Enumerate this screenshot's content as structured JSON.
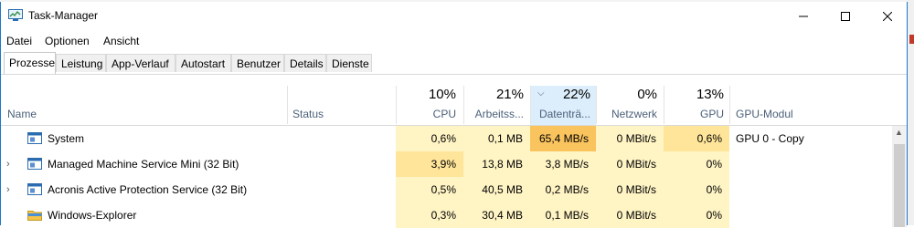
{
  "window": {
    "title": "Task-Manager",
    "accent": "#1979ca"
  },
  "menu": [
    "Datei",
    "Optionen",
    "Ansicht"
  ],
  "tabs": [
    {
      "label": "Prozesse",
      "active": true
    },
    {
      "label": "Leistung"
    },
    {
      "label": "App-Verlauf"
    },
    {
      "label": "Autostart"
    },
    {
      "label": "Benutzer"
    },
    {
      "label": "Details"
    },
    {
      "label": "Dienste"
    }
  ],
  "columns": {
    "name": "Name",
    "status": "Status",
    "cpu": {
      "pct": "10%",
      "label": "CPU"
    },
    "mem": {
      "pct": "21%",
      "label": "Arbeitss..."
    },
    "disk": {
      "pct": "22%",
      "label": "Datenträ...",
      "sorted": true
    },
    "net": {
      "pct": "0%",
      "label": "Netzwerk"
    },
    "gpu": {
      "pct": "13%",
      "label": "GPU"
    },
    "gpumod": "GPU-Modul"
  },
  "rows": [
    {
      "name": "System",
      "expandable": false,
      "icon": "system-window-icon",
      "cpu": "0,6%",
      "mem": "0,1 MB",
      "disk": "65,4 MB/s",
      "net": "0 MBit/s",
      "gpu": "0,6%",
      "gpumod": "GPU 0 - Copy"
    },
    {
      "name": "Managed Machine Service Mini (32 Bit)",
      "expandable": true,
      "icon": "app-window-icon",
      "cpu": "3,9%",
      "mem": "13,8 MB",
      "disk": "3,8 MB/s",
      "net": "0 MBit/s",
      "gpu": "0%",
      "gpumod": ""
    },
    {
      "name": "Acronis Active Protection Service (32 Bit)",
      "expandable": true,
      "icon": "app-window-icon",
      "cpu": "0,5%",
      "mem": "40,5 MB",
      "disk": "0,2 MB/s",
      "net": "0 MBit/s",
      "gpu": "0%",
      "gpumod": ""
    },
    {
      "name": "Windows-Explorer",
      "expandable": false,
      "icon": "folder-icon",
      "cpu": "0,3%",
      "mem": "30,4 MB",
      "disk": "0,1 MB/s",
      "net": "0 MBit/s",
      "gpu": "0%",
      "gpumod": ""
    }
  ],
  "heat": {
    "light": "#fff4c4",
    "medium": "#ffe59a",
    "strong": "#fcd27a",
    "hot": "#f9c35e"
  }
}
